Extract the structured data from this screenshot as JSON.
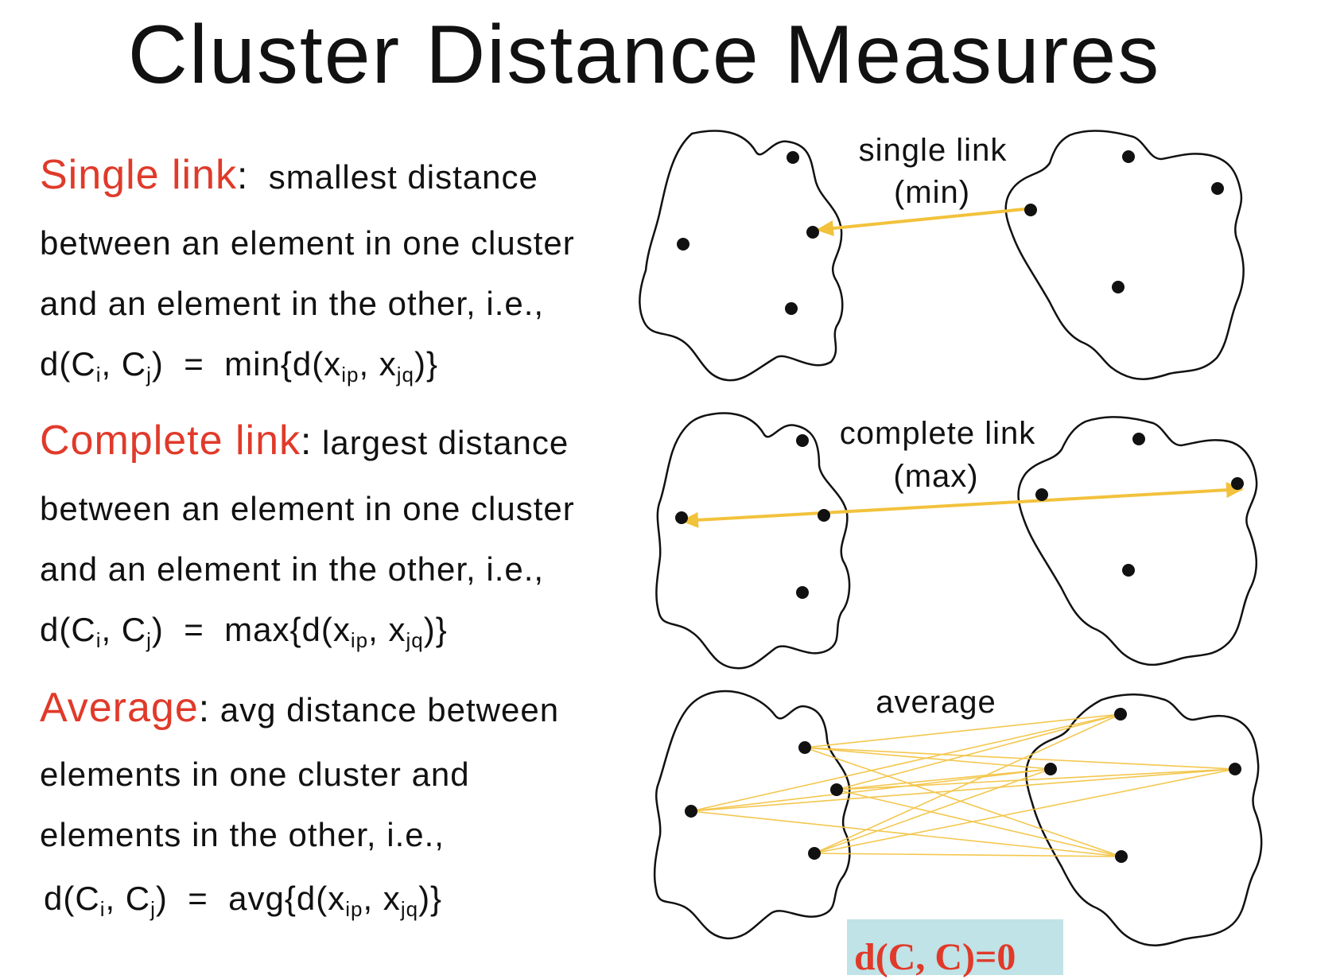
{
  "title": "Cluster Distance Measures",
  "single": {
    "term": "Single link",
    "colon": ":",
    "line1": "smallest distance",
    "line2": "between an element in one cluster",
    "line3": "and an element in the other, i.e.,",
    "formula": {
      "func": "min"
    }
  },
  "complete": {
    "term": "Complete link",
    "colon": ":",
    "line1": "largest distance",
    "line2": "between an element in one cluster",
    "line3": "and an element in the other, i.e.,",
    "formula": {
      "func": "max"
    }
  },
  "average": {
    "term": "Average",
    "colon": ":",
    "line1": "avg distance between",
    "line2": "elements in one cluster and",
    "line3": "elements in the other, i.e.,",
    "formula": {
      "func": "avg"
    }
  },
  "formula_parts": {
    "d_open": "d(C",
    "i": "i",
    "comma": ", C",
    "j": "j",
    "close_eq": ")  =  ",
    "brace_d": "{d(x",
    "ip": "ip",
    "comma_x": ", x",
    "jq": "jq",
    "end": ")}"
  },
  "diagram": {
    "single_label_1": "single link",
    "single_label_2": "(min)",
    "complete_label_1": "complete link",
    "complete_label_2": "(max)",
    "average_label": "average"
  },
  "note": "d(C, C)=0",
  "colors": {
    "term": "#e03a2a",
    "link": "#f2c23c",
    "note_bg": "#bfe3e6"
  }
}
